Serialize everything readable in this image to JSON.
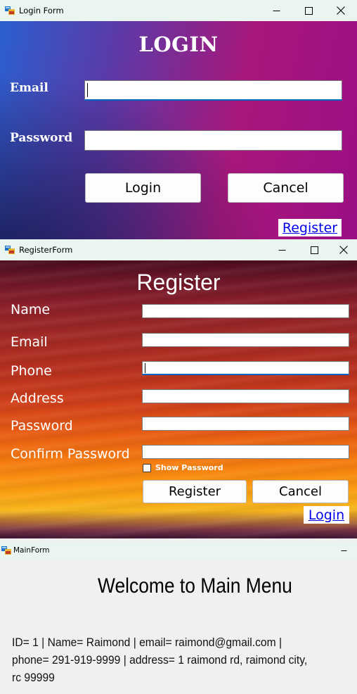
{
  "login_window": {
    "title": "Login Form",
    "heading": "LOGIN",
    "email_label": "Email",
    "email_value": "",
    "password_label": "Password",
    "password_value": "",
    "login_button": "Login",
    "cancel_button": "Cancel",
    "register_link": "Register"
  },
  "register_window": {
    "title": "RegisterForm",
    "heading": "Register",
    "name_label": "Name",
    "email_label": "Email",
    "phone_label": "Phone",
    "address_label": "Address",
    "password_label": "Password",
    "confirm_password_label": "Confirm Password",
    "show_password_label": "Show Password",
    "show_password_checked": false,
    "register_button": "Register",
    "cancel_button": "Cancel",
    "login_link": "Login"
  },
  "main_window": {
    "title": "MainForm",
    "heading": "Welcome to Main Menu",
    "user_info": "ID= 1 | Name= Raimond | email= raimond@gmail.com | phone= 291-919-9999 | address= 1 raimond rd, raimond city, rc 99999"
  },
  "icons": {
    "app_icon": "winforms-app-icon",
    "minimize": "minimize-icon",
    "maximize": "maximize-icon",
    "close": "close-icon"
  },
  "colors": {
    "link": "#0000ee",
    "focus_underline": "#0067c0",
    "titlebar": "#eaf5ef"
  }
}
